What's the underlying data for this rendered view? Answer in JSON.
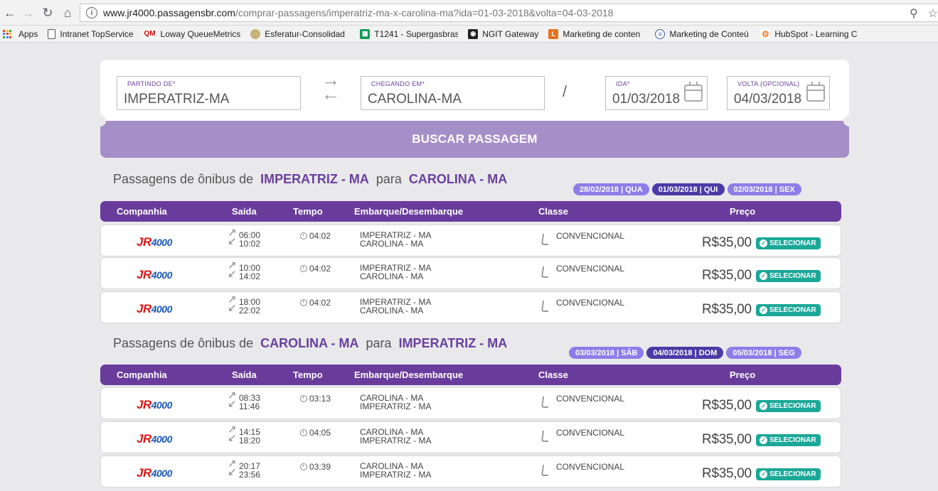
{
  "browser": {
    "url_host": "www.jr4000.passagensbr.com",
    "url_path": "/comprar-passagens/imperatriz-ma-x-carolina-ma?ida=01-03-2018&volta=04-03-2018",
    "bookmarks": [
      {
        "label": "Apps",
        "icon": "apps-grid-icon"
      },
      {
        "label": "Intranet TopService",
        "icon": "page-icon"
      },
      {
        "label": "Loway QueueMetrics",
        "icon": "qm-icon"
      },
      {
        "label": "Esferatur-Consolidad",
        "icon": "esferatur-icon"
      },
      {
        "label": "T1241 - Supergasbras",
        "icon": "sheets-icon"
      },
      {
        "label": "NGIT Gateway",
        "icon": "ngit-icon"
      },
      {
        "label": "Marketing de conten",
        "icon": "l-icon"
      },
      {
        "label": "Marketing de Conteú",
        "icon": "doc-icon"
      },
      {
        "label": "HubSpot - Learning C",
        "icon": "hubspot-icon"
      }
    ]
  },
  "search": {
    "origin_label": "PARTINDO DE*",
    "origin_value": "IMPERATRIZ-MA",
    "dest_label": "CHEGANDO EM*",
    "dest_value": "CAROLINA-MA",
    "slash": "/",
    "ida_label": "IDA*",
    "ida_value": "01/03/2018",
    "volta_label": "VOLTA (OPCIONAL)",
    "volta_value": "04/03/2018",
    "button": "BUSCAR PASSAGEM"
  },
  "table_headers": [
    "Companhia",
    "Saída",
    "Tempo",
    "Embarque/Desembarque",
    "Classe",
    "Preço"
  ],
  "sections": [
    {
      "prefix": "Passagens de ônibus de",
      "from": "IMPERATRIZ - MA",
      "joiner": "para",
      "to": "CAROLINA - MA",
      "dates": [
        {
          "label": "28/02/2018 | QUA",
          "active": false
        },
        {
          "label": "01/03/2018 | QUI",
          "active": true
        },
        {
          "label": "02/03/2018 | SEX",
          "active": false
        }
      ],
      "rows": [
        {
          "logo": "JR",
          "logo_num": "4000",
          "dep": "06:00",
          "arr": "10:02",
          "duration": "04:02",
          "embark": "IMPERATRIZ - MA",
          "disembark": "CAROLINA - MA",
          "class": "CONVENCIONAL",
          "price": "R$35,00",
          "button": "SELECIONAR"
        },
        {
          "logo": "JR",
          "logo_num": "4000",
          "dep": "10:00",
          "arr": "14:02",
          "duration": "04:02",
          "embark": "IMPERATRIZ - MA",
          "disembark": "CAROLINA - MA",
          "class": "CONVENCIONAL",
          "price": "R$35,00",
          "button": "SELECIONAR"
        },
        {
          "logo": "JR",
          "logo_num": "4000",
          "dep": "18:00",
          "arr": "22:02",
          "duration": "04:02",
          "embark": "IMPERATRIZ - MA",
          "disembark": "CAROLINA - MA",
          "class": "CONVENCIONAL",
          "price": "R$35,00",
          "button": "SELECIONAR"
        }
      ]
    },
    {
      "prefix": "Passagens de ônibus de",
      "from": "CAROLINA - MA",
      "joiner": "para",
      "to": "IMPERATRIZ - MA",
      "dates": [
        {
          "label": "03/03/2018 | SÁB",
          "active": false
        },
        {
          "label": "04/03/2018 | DOM",
          "active": true
        },
        {
          "label": "05/03/2018 | SEG",
          "active": false
        }
      ],
      "rows": [
        {
          "logo": "JR",
          "logo_num": "4000",
          "dep": "08:33",
          "arr": "11:46",
          "duration": "03:13",
          "embark": "CAROLINA - MA",
          "disembark": "IMPERATRIZ - MA",
          "class": "CONVENCIONAL",
          "price": "R$35,00",
          "button": "SELECIONAR"
        },
        {
          "logo": "JR",
          "logo_num": "4000",
          "dep": "14:15",
          "arr": "18:20",
          "duration": "04:05",
          "embark": "CAROLINA - MA",
          "disembark": "IMPERATRIZ - MA",
          "class": "CONVENCIONAL",
          "price": "R$35,00",
          "button": "SELECIONAR"
        },
        {
          "logo": "JR",
          "logo_num": "4000",
          "dep": "20:17",
          "arr": "23:56",
          "duration": "03:39",
          "embark": "CAROLINA - MA",
          "disembark": "IMPERATRIZ - MA",
          "class": "CONVENCIONAL",
          "price": "R$35,00",
          "button": "SELECIONAR"
        }
      ]
    }
  ],
  "colors": {
    "accent_purple": "#693c9c",
    "button_lilac": "#a68fc8",
    "select_teal": "#1aa898",
    "logo_red": "#d51a1a",
    "logo_blue": "#1b59b8"
  }
}
